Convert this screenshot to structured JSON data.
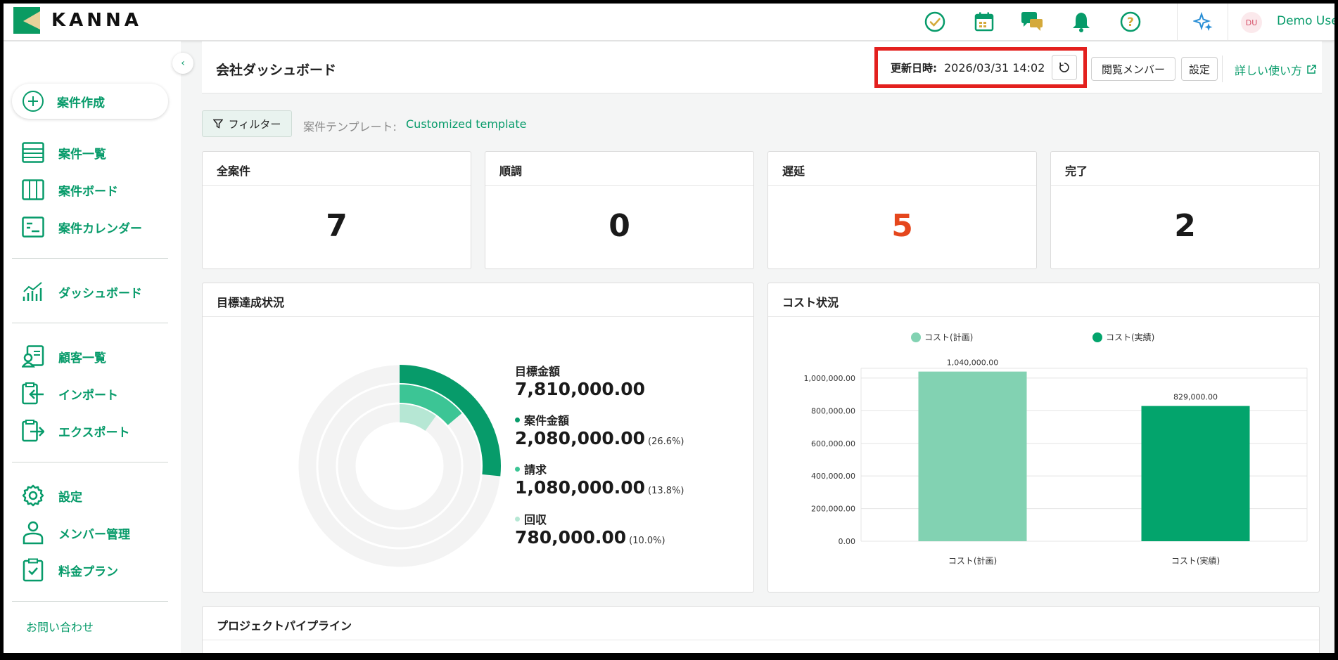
{
  "app": {
    "logo_text": "KANNA"
  },
  "topbar": {
    "user_avatar": "DU",
    "user_name": "Demo User"
  },
  "sidebar": {
    "create_label": "案件作成",
    "items": [
      {
        "label": "案件一覧"
      },
      {
        "label": "案件ボード"
      },
      {
        "label": "案件カレンダー"
      },
      {
        "label": "ダッシュボード"
      },
      {
        "label": "顧客一覧"
      },
      {
        "label": "インポート"
      },
      {
        "label": "エクスポート"
      },
      {
        "label": "設定"
      },
      {
        "label": "メンバー管理"
      },
      {
        "label": "料金プラン"
      }
    ],
    "contact": "お問い合わせ"
  },
  "header": {
    "title": "会社ダッシュボード",
    "updated_label": "更新日時:",
    "updated_value": "2026/03/31 14:02",
    "viewers_button": "閲覧メンバー",
    "settings_button": "設定",
    "help_link": "詳しい使い方"
  },
  "filter": {
    "button_label": "フィルター",
    "template_label": "案件テンプレート:",
    "template_value": "Customized template"
  },
  "stats": [
    {
      "title": "全案件",
      "value": "7",
      "color": "#1a1a1a"
    },
    {
      "title": "順調",
      "value": "0",
      "color": "#1a1a1a"
    },
    {
      "title": "遅延",
      "value": "5",
      "color": "#e5471d"
    },
    {
      "title": "完了",
      "value": "2",
      "color": "#1a1a1a"
    }
  ],
  "goal": {
    "title": "目標達成状況",
    "target_label": "目標金額",
    "target_value": "7,810,000.00",
    "rows": [
      {
        "label": "案件金額",
        "value": "2,080,000.00",
        "pct": "(26.6%)",
        "ratio": 0.266,
        "color": "#079b6a"
      },
      {
        "label": "請求",
        "value": "1,080,000.00",
        "pct": "(13.8%)",
        "ratio": 0.138,
        "color": "#3cc595"
      },
      {
        "label": "回収",
        "value": "780,000.00",
        "pct": "(10.0%)",
        "ratio": 0.1,
        "color": "#b6e7d4"
      }
    ]
  },
  "pipeline": {
    "title": "プロジェクトパイプライン"
  },
  "chart_data": {
    "type": "bar",
    "title": "コスト状況",
    "categories": [
      "コスト(計画)",
      "コスト(実績)"
    ],
    "values": [
      1040000,
      829000
    ],
    "value_labels": [
      "1,040,000.00",
      "829,000.00"
    ],
    "series_names": [
      "コスト(計画)",
      "コスト(実績)"
    ],
    "colors": [
      "#82d2b2",
      "#03a46c"
    ],
    "yticks": [
      "0.00",
      "200,000.00",
      "400,000.00",
      "600,000.00",
      "800,000.00",
      "1,000,000.00"
    ],
    "ylim": [
      0,
      1060000
    ],
    "legend": "top",
    "grid": true
  }
}
